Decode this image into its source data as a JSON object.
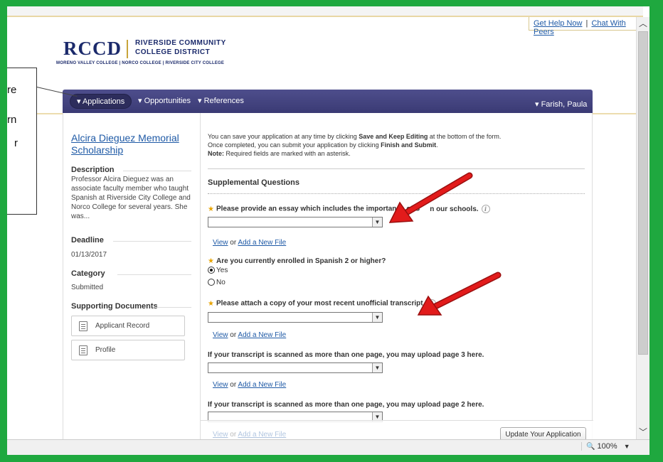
{
  "header": {
    "help_link": "Get Help Now",
    "chat_link": "Chat With Peers",
    "separator": "|"
  },
  "logo": {
    "abbrev": "RCCD",
    "name_line1": "RIVERSIDE COMMUNITY",
    "name_line2": "COLLEGE DISTRICT",
    "colleges": "MORENO VALLEY COLLEGE | NORCO COLLEGE | RIVERSIDE CITY COLLEGE"
  },
  "nav": {
    "applications": "▾ Applications",
    "opportunities": "▾ Opportunities",
    "references": "▾ References",
    "user": "▾ Farish, Paula"
  },
  "sidebar": {
    "title": "Alcira Dieguez Memorial Scholarship",
    "description_head": "Description",
    "description": "Professor Alcira Dieguez was an associate faculty member who taught Spanish at Riverside City College and Norco College for several years. She was...",
    "deadline_head": "Deadline",
    "deadline": "01/13/2017",
    "category_head": "Category",
    "category": "Submitted",
    "supporting_head": "Supporting Documents",
    "documents": [
      "Applicant Record",
      "Profile"
    ]
  },
  "intro": {
    "line1_a": "You can save your application at any time by clicking ",
    "line1_b": "Save and Keep Editing",
    "line1_c": " at the bottom of the form.",
    "line2_a": "Once completed, you can submit your application by clicking ",
    "line2_b": "Finish and Submit",
    "line2_c": ".",
    "note_label": "Note:",
    "note_text": " Required fields are marked with an asterisk."
  },
  "form": {
    "section_title": "Supplemental Questions",
    "q1": "Please provide an essay which includes the importance of S",
    "q1_tail": "n our schools.",
    "q2": "Are you currently enrolled in Spanish 2 or higher?",
    "q2_options": [
      "Yes",
      "No"
    ],
    "q2_selected": "Yes",
    "q3": "Please attach a copy of your most recent unofficial transcript.",
    "q4": "If your transcript is scanned as more than one page, you may upload page 3 here.",
    "q5": "If your transcript is scanned as more than one page, you may upload page 2 here.",
    "view_label": "View",
    "or_label": " or ",
    "add_label": "Add a New File",
    "star": "★",
    "info": "i"
  },
  "footer": {
    "update_button": "Update Your Application"
  },
  "status": {
    "zoom": "100%",
    "zoom_icon": "🔍",
    "dropdown": "▼"
  },
  "callout": {
    "frag1": "re",
    "frag2": "rn",
    "frag3": "r"
  },
  "colors": {
    "border_green": "#1fa83f",
    "nav_purple": "#3f3f7c",
    "link_blue": "#1f5aa6",
    "arrow_red": "#e21b1b"
  }
}
